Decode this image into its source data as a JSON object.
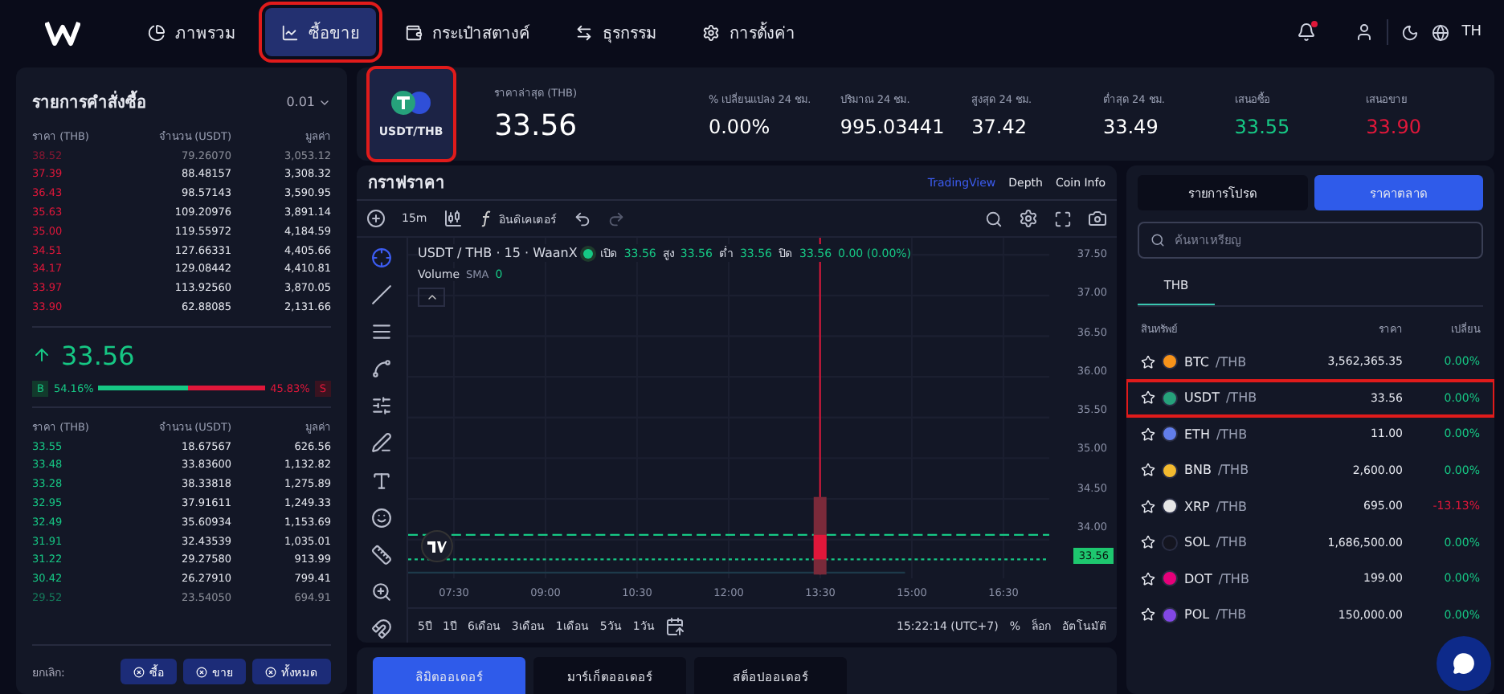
{
  "nav": {
    "items": [
      {
        "label": "ภาพรวม",
        "selected": false,
        "highlighted": false
      },
      {
        "label": "ซื้อขาย",
        "selected": true,
        "highlighted": true
      },
      {
        "label": "กระเป๋าสตางค์",
        "selected": false,
        "highlighted": false
      },
      {
        "label": "ธุรกรรม",
        "selected": false,
        "highlighted": false
      },
      {
        "label": "การตั้งค่า",
        "selected": false,
        "highlighted": false
      }
    ],
    "notification": true,
    "language": "TH"
  },
  "order_book": {
    "title": "รายการคำสั่งซื้อ",
    "precision": "0.01",
    "columns": [
      "ราคา (THB)",
      "จำนวน (USDT)",
      "มูลค่า"
    ],
    "asks": [
      {
        "price": "38.52",
        "amount": "79.26070",
        "value": "3,053.12",
        "faded": true
      },
      {
        "price": "37.39",
        "amount": "88.48157",
        "value": "3,308.32",
        "faded": false
      },
      {
        "price": "36.43",
        "amount": "98.57143",
        "value": "3,590.95",
        "faded": false
      },
      {
        "price": "35.63",
        "amount": "109.20976",
        "value": "3,891.14",
        "faded": false
      },
      {
        "price": "35.00",
        "amount": "119.55972",
        "value": "4,184.59",
        "faded": false
      },
      {
        "price": "34.51",
        "amount": "127.66331",
        "value": "4,405.66",
        "faded": false
      },
      {
        "price": "34.17",
        "amount": "129.08442",
        "value": "4,410.81",
        "faded": false
      },
      {
        "price": "33.97",
        "amount": "113.92560",
        "value": "3,870.05",
        "faded": false
      },
      {
        "price": "33.90",
        "amount": "62.88085",
        "value": "2,131.66",
        "faded": false
      }
    ],
    "last_price": "33.56",
    "buy_label": "B",
    "buy_share": "54.16%",
    "sell_share": "45.83%",
    "sell_label": "S",
    "level": 0.5416,
    "bid_columns": [
      "ราคา (THB)",
      "จำนวน (USDT)",
      "มูลค่า"
    ],
    "bids": [
      {
        "price": "33.55",
        "amount": "18.67567",
        "value": "626.56",
        "faded": false
      },
      {
        "price": "33.48",
        "amount": "33.83600",
        "value": "1,132.82",
        "faded": false
      },
      {
        "price": "33.28",
        "amount": "38.33818",
        "value": "1,275.89",
        "faded": false
      },
      {
        "price": "32.95",
        "amount": "37.91611",
        "value": "1,249.33",
        "faded": false
      },
      {
        "price": "32.49",
        "amount": "35.60934",
        "value": "1,153.69",
        "faded": false
      },
      {
        "price": "31.91",
        "amount": "32.43539",
        "value": "1,035.01",
        "faded": false
      },
      {
        "price": "31.22",
        "amount": "29.27580",
        "value": "913.99",
        "faded": false
      },
      {
        "price": "30.42",
        "amount": "26.27910",
        "value": "799.41",
        "faded": false
      },
      {
        "price": "29.52",
        "amount": "23.54050",
        "value": "694.91",
        "faded": true
      }
    ],
    "cancel_label": "ยกเลิก:",
    "cancel_buttons": [
      "ซื้อ",
      "ขาย",
      "ทั้งหมด"
    ]
  },
  "ticker": {
    "pair": "USDT/THB",
    "highlighted": true,
    "stats": [
      {
        "label": "ราคาล่าสุด (THB)",
        "value": "33.56",
        "kind": "main"
      },
      {
        "label": "% เปลี่ยนแปลง 24 ชม.",
        "value": "0.00%",
        "kind": "plain"
      },
      {
        "label": "ปริมาณ 24 ชม.",
        "value": "995.03441",
        "kind": "plain"
      },
      {
        "label": "สูงสุด 24 ชม.",
        "value": "37.42",
        "kind": "plain"
      },
      {
        "label": "ต่ำสุด 24 ชม.",
        "value": "33.49",
        "kind": "plain"
      },
      {
        "label": "เสนอซื้อ",
        "value": "33.55",
        "kind": "up"
      },
      {
        "label": "เสนอขาย",
        "value": "33.90",
        "kind": "down"
      }
    ]
  },
  "chart": {
    "title": "กราฟราคา",
    "views": [
      {
        "label": "TradingView",
        "selected": true
      },
      {
        "label": "Depth",
        "selected": false
      },
      {
        "label": "Coin Info",
        "selected": false
      }
    ],
    "interval": "15m",
    "indicators": "อินดิเคเตอร์",
    "legend": {
      "symbol": "USDT / THB · 15 · WaanX",
      "open_label": "เปิด",
      "open": "33.56",
      "high_label": "สูง",
      "high": "33.56",
      "low_label": "ต่ำ",
      "low": "33.56",
      "close_label": "ปิด",
      "close": "33.56",
      "change": "0.00 (0.00%)",
      "volume_label": "Volume",
      "volume_kind": "SMA",
      "volume_value": "0"
    },
    "price_ticks": [
      "37.50",
      "37.00",
      "36.50",
      "36.00",
      "35.50",
      "35.00",
      "34.50",
      "34.00"
    ],
    "current_price": "33.56",
    "time_ticks": [
      "07:30",
      "09:00",
      "10:30",
      "12:00",
      "13:30",
      "15:00",
      "16:30"
    ],
    "ranges": [
      "5ปี",
      "1ปี",
      "6เดือน",
      "3เดือน",
      "1เดือน",
      "5วัน",
      "1วัน"
    ],
    "clock": "15:22:14 (UTC+7)",
    "percent": "%",
    "log": "ล็อก",
    "auto": "อัตโนมัติ"
  },
  "order_tabs": [
    {
      "label": "ลิมิตออเดอร์",
      "selected": true
    },
    {
      "label": "มาร์เก็ตออเดอร์",
      "selected": false
    },
    {
      "label": "สต็อปออเดอร์",
      "selected": false
    }
  ],
  "market": {
    "tabs": [
      {
        "label": "รายการโปรด",
        "selected": false
      },
      {
        "label": "ราคาตลาด",
        "selected": true
      }
    ],
    "search": {
      "placeholder": "ค้นหาเหรียญ"
    },
    "quote_tab": "THB",
    "columns": [
      "สินทรัพย์",
      "ราคา",
      "เปลี่ยน"
    ],
    "rows": [
      {
        "base": "BTC",
        "quote": "/THB",
        "price": "3,562,365.35",
        "change": "0.00%",
        "negative": false,
        "color": "#f7931a",
        "highlighted": false
      },
      {
        "base": "USDT",
        "quote": "/THB",
        "price": "33.56",
        "change": "0.00%",
        "negative": false,
        "color": "#26a17b",
        "highlighted": true
      },
      {
        "base": "ETH",
        "quote": "/THB",
        "price": "11.00",
        "change": "0.00%",
        "negative": false,
        "color": "#627eea",
        "highlighted": false
      },
      {
        "base": "BNB",
        "quote": "/THB",
        "price": "2,600.00",
        "change": "0.00%",
        "negative": false,
        "color": "#f3ba2f",
        "highlighted": false
      },
      {
        "base": "XRP",
        "quote": "/THB",
        "price": "695.00",
        "change": "-13.13%",
        "negative": true,
        "color": "#e6e6e6",
        "highlighted": false
      },
      {
        "base": "SOL",
        "quote": "/THB",
        "price": "1,686,500.00",
        "change": "0.00%",
        "negative": false,
        "color": "#14151f",
        "highlighted": false
      },
      {
        "base": "DOT",
        "quote": "/THB",
        "price": "199.00",
        "change": "0.00%",
        "negative": false,
        "color": "#e6007a",
        "highlighted": false
      },
      {
        "base": "POL",
        "quote": "/THB",
        "price": "150,000.00",
        "change": "0.00%",
        "negative": false,
        "color": "#8247e5",
        "highlighted": false
      }
    ]
  }
}
